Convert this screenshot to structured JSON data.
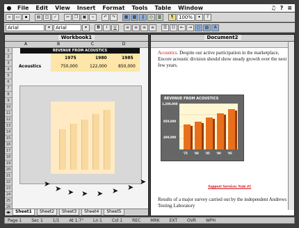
{
  "menubar": {
    "apple": "",
    "items": [
      "File",
      "Edit",
      "View",
      "Insert",
      "Format",
      "Tools",
      "Table",
      "Window"
    ],
    "right": [
      "♫",
      "?",
      "≡"
    ]
  },
  "toolbar": {
    "font_left": "Arial",
    "font_right": "Arial",
    "zoom": "100%"
  },
  "workbook": {
    "title": "Workbook1",
    "columns": [
      "A",
      "B",
      "C",
      "D"
    ],
    "table_title": "REVENUE FROM ACOUSTICS",
    "years": [
      "1975",
      "1980",
      "1985"
    ],
    "row_label": "Acoustics",
    "values": [
      "750,000",
      "122,000",
      "850,000"
    ],
    "tabs": [
      "Sheet1",
      "Sheet2",
      "Sheet3",
      "Sheet4",
      "Sheet5"
    ]
  },
  "document": {
    "title": "Document2",
    "para1_keyword": "Acoustics.",
    "para1": " Despite our active participation in the marketplace, Encore acoustic division should show steady growth over the next few years.",
    "chart_title": "REVENUE FROM ACOUSTICS",
    "y_labels": [
      "1,200,000",
      "850,000",
      "400,000"
    ],
    "x_labels": [
      "'75",
      "'80",
      "'85",
      "'90",
      "'95"
    ],
    "link_text": "Support Services Note #1",
    "para2": "Results of a major survey carried out by the independent Andrews Testing Laboratory"
  },
  "statusbar": [
    "Page 1",
    "Sec 1",
    "1/1",
    "At 1.7\"",
    "Ln 1",
    "Col 1",
    "REC",
    "MRK",
    "EXT",
    "OVR",
    "WPH"
  ],
  "colors": {
    "accent_red": "#c0171c",
    "bar_orange": "#e8701c",
    "cell_yellow": "#fde6a8"
  }
}
